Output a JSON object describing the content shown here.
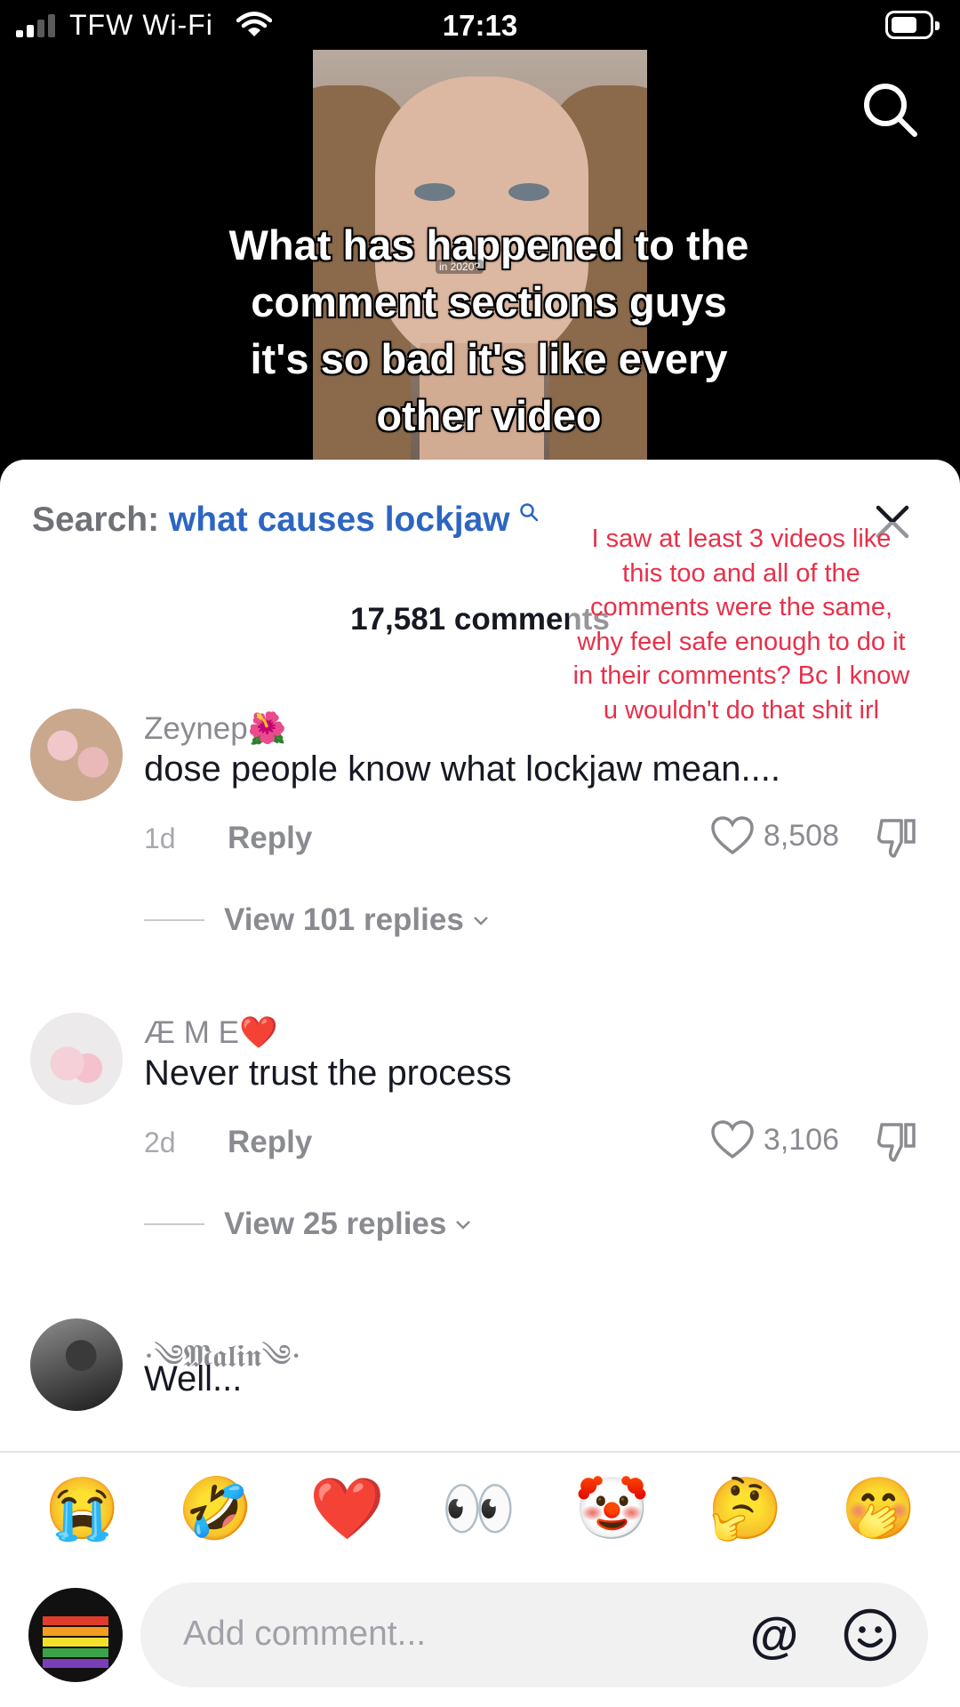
{
  "status_bar": {
    "carrier": "TFW Wi-Fi",
    "time": "17:13"
  },
  "video": {
    "caption": "What has happened to the comment sections guys it's so bad it's like every other video",
    "sticker": "in 2020?"
  },
  "comments_panel": {
    "search_prefix": "Search:",
    "search_query": "what causes lockjaw",
    "comment_count": "17,581 comments",
    "overlay_note": "I saw at least 3 videos like this too and all of the comments were the same, why feel safe enough to do it in their comments? Bc I know u wouldn't do that shit irl",
    "comments": [
      {
        "author": "Zeynep🌺",
        "text": "dose people know what lockjaw mean....",
        "time": "1d",
        "reply_label": "Reply",
        "likes": "8,508",
        "view_replies": "View 101 replies"
      },
      {
        "author": "Æ M E❤️",
        "text": "Never trust the process",
        "time": "2d",
        "reply_label": "Reply",
        "likes": "3,106",
        "view_replies": "View 25 replies"
      },
      {
        "author": "·༄𝕸𝖆𝖑𝖎𝖓༄·",
        "text": "Well..."
      }
    ]
  },
  "emoji_bar": [
    "😭",
    "🤣",
    "❤️",
    "👀",
    "🤡",
    "🤔",
    "🤭"
  ],
  "input": {
    "placeholder": "Add comment...",
    "mention_symbol": "@"
  },
  "colors": {
    "search_query": "#2d65c2",
    "overlay_note": "#e8304a",
    "secondary_text": "#8a8b91"
  }
}
